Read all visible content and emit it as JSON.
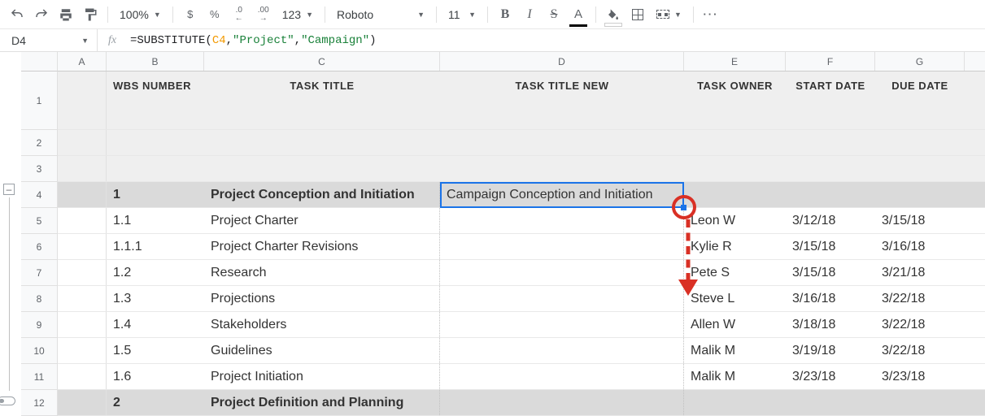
{
  "toolbar": {
    "zoom": "100%",
    "dollar": "$",
    "percent": "%",
    "dec_dec": ".0",
    "dec_inc": ".00",
    "num_fmt": "123",
    "font": "Roboto",
    "font_size": "11",
    "bold": "B",
    "italic": "I",
    "strike": "S",
    "text_color": "A",
    "more": "···"
  },
  "formula_bar": {
    "name_box": "D4",
    "fx": "fx",
    "prefix": "=SUBSTITUTE(",
    "ref": "C4",
    "mid1": ",",
    "str1": "\"Project\"",
    "mid2": ",",
    "str2": "\"Campaign\"",
    "suffix": ")"
  },
  "columns": {
    "A": "A",
    "B": "B",
    "C": "C",
    "D": "D",
    "E": "E",
    "F": "F",
    "G": "G"
  },
  "rows": [
    "1",
    "2",
    "3",
    "4",
    "5",
    "6",
    "7",
    "8",
    "9",
    "10",
    "11",
    "12"
  ],
  "headers": {
    "wbs": "WBS NUMBER",
    "title": "TASK TITLE",
    "title_new": "TASK TITLE NEW",
    "owner": "TASK OWNER",
    "start": "START DATE",
    "due": "DUE DATE"
  },
  "group1": {
    "wbs": "1",
    "title": "Project Conception and Initiation",
    "title_new": "Campaign Conception and Initiation"
  },
  "tasks": [
    {
      "wbs": "1.1",
      "title": "Project Charter",
      "owner": "Leon W",
      "start": "3/12/18",
      "due": "3/15/18"
    },
    {
      "wbs": "1.1.1",
      "title": "Project Charter Revisions",
      "owner": "Kylie R",
      "start": "3/15/18",
      "due": "3/16/18"
    },
    {
      "wbs": "1.2",
      "title": "Research",
      "owner": "Pete S",
      "start": "3/15/18",
      "due": "3/21/18"
    },
    {
      "wbs": "1.3",
      "title": "Projections",
      "owner": "Steve L",
      "start": "3/16/18",
      "due": "3/22/18"
    },
    {
      "wbs": "1.4",
      "title": "Stakeholders",
      "owner": "Allen W",
      "start": "3/18/18",
      "due": "3/22/18"
    },
    {
      "wbs": "1.5",
      "title": "Guidelines",
      "owner": "Malik M",
      "start": "3/19/18",
      "due": "3/22/18"
    },
    {
      "wbs": "1.6",
      "title": "Project Initiation",
      "owner": "Malik M",
      "start": "3/23/18",
      "due": "3/23/18"
    }
  ],
  "group2": {
    "wbs": "2",
    "title": "Project Definition and Planning"
  },
  "outline": {
    "minus": "–"
  }
}
